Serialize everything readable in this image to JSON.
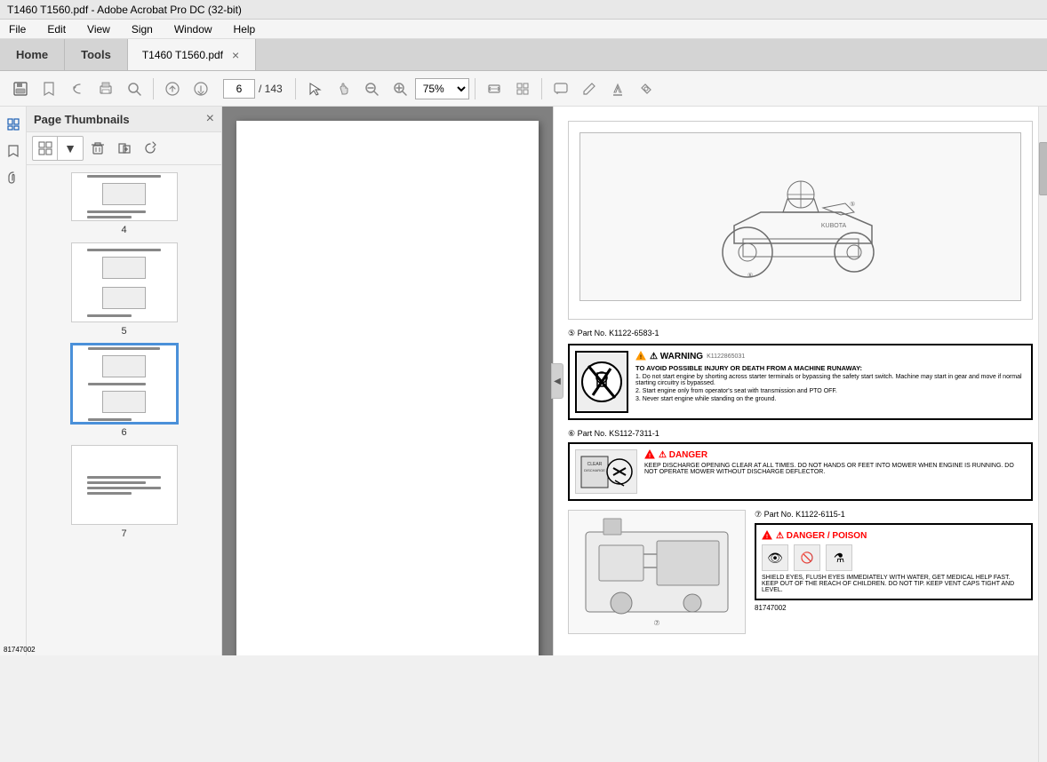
{
  "window": {
    "title": "T1460 T1560.pdf - Adobe Acrobat Pro DC (32-bit)"
  },
  "menu": {
    "items": [
      "File",
      "Edit",
      "View",
      "Sign",
      "Window",
      "Help"
    ]
  },
  "tabs": {
    "home_label": "Home",
    "tools_label": "Tools",
    "file_tab_label": "T1460 T1560.pdf",
    "close_symbol": "×"
  },
  "toolbar": {
    "save_icon": "💾",
    "bookmark_icon": "☆",
    "back_icon": "↩",
    "print_icon": "🖨",
    "search_icon": "🔍",
    "prev_page_icon": "↑",
    "next_page_icon": "↓",
    "current_page": "6",
    "total_pages": "143",
    "cursor_icon": "↖",
    "hand_icon": "✋",
    "zoom_out_icon": "−",
    "zoom_in_icon": "+",
    "zoom_value": "75%",
    "fit_icon": "⊡",
    "select_icon": "⊞",
    "comment_icon": "💬",
    "pen_icon": "✏",
    "highlight_icon": "✒",
    "stamp_icon": "📌"
  },
  "sidebar": {
    "title": "Page Thumbnails",
    "close_icon": "×",
    "page_items": [
      {
        "page_num": "4",
        "active": false
      },
      {
        "page_num": "5",
        "active": false
      },
      {
        "page_num": "6",
        "active": true
      },
      {
        "page_num": "7",
        "active": false
      }
    ]
  },
  "left_icons": [
    {
      "name": "pages-icon",
      "symbol": "⊞",
      "active": true
    },
    {
      "name": "bookmarks-icon",
      "symbol": "🔖",
      "active": false
    },
    {
      "name": "attachments-icon",
      "symbol": "📎",
      "active": false
    }
  ],
  "pdf_content": {
    "part1": {
      "caption": "⑤ Part No. K1122-6583-1",
      "warning_title": "⚠ WARNING",
      "warning_number": "K1122865031",
      "warning_text": "TO AVOID POSSIBLE INJURY OR DEATH FROM A MACHINE RUNAWAY:",
      "warning_points": [
        "1. Do not start engine by shorting across starter terminals or bypassing the safety start switch. Machine may start in gear and move if normal starting circuitry is bypassed.",
        "2. Start engine only from operator's seat with transmission and PTO OFF.",
        "3. Never start engine while standing on the ground."
      ]
    },
    "part2": {
      "caption": "⑥ Part No. KS112-7311-1",
      "danger_title": "⚠ DANGER",
      "danger_text": "KEEP DISCHARGE OPENING CLEAR AT ALL TIMES. DO NOT HANDS OR FEET INTO MOWER WHEN ENGINE IS RUNNING. DO NOT OPERATE MOWER WITHOUT DISCHARGE DEFLECTOR."
    },
    "part3": {
      "caption": "⑦ Part No. K1122-6115-1",
      "danger_poison_title": "⚠ DANGER / POISON",
      "danger_text2": "SHIELD EYES, FLUSH EYES IMMEDIATELY WITH WATER, GET MEDICAL HELP FAST. KEEP OUT OF THE REACH OF CHILDREN. DO NOT TIP. KEEP VENT CAPS TIGHT AND LEVEL.",
      "fig_number": "81747002"
    }
  }
}
